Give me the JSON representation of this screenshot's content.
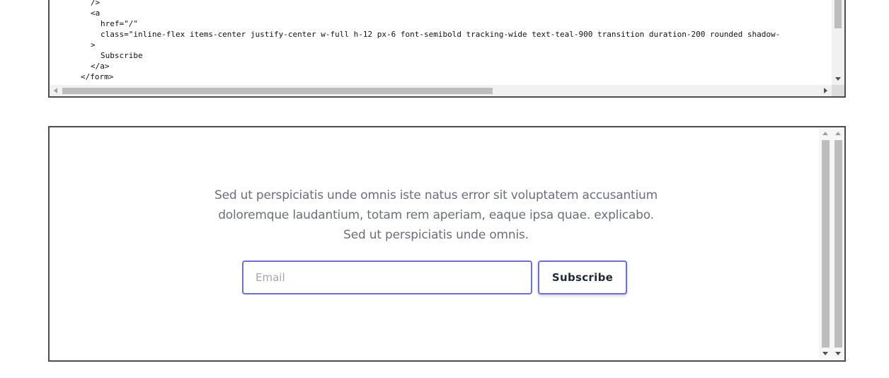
{
  "code_panel": {
    "lines": [
      {
        "text": "/>",
        "indent": 3
      },
      {
        "text": "<a",
        "indent": 3
      },
      {
        "text": "href=\"/\"",
        "indent": 4
      },
      {
        "text": "class=\"inline-flex items-center justify-center w-full h-12 px-6 font-semibold tracking-wide text-teal-900 transition duration-200 rounded shadow-",
        "indent": 4
      },
      {
        "text": ">",
        "indent": 3
      },
      {
        "text": "Subscribe",
        "indent": 4
      },
      {
        "text": "</a>",
        "indent": 3
      },
      {
        "text": "</form>",
        "indent": 2
      }
    ]
  },
  "preview": {
    "description": "Sed ut perspiciatis unde omnis iste natus error sit voluptatem accusantium doloremque laudantium, totam rem aperiam, eaque ipsa quae. explicabo. Sed ut perspiciatis unde omnis.",
    "email": {
      "placeholder": "Email",
      "value": ""
    },
    "subscribe_label": "Subscribe"
  },
  "colors": {
    "accent_border": "#6a6ee0",
    "panel_border": "#4a4f4d",
    "text_muted": "#6b6f78"
  }
}
